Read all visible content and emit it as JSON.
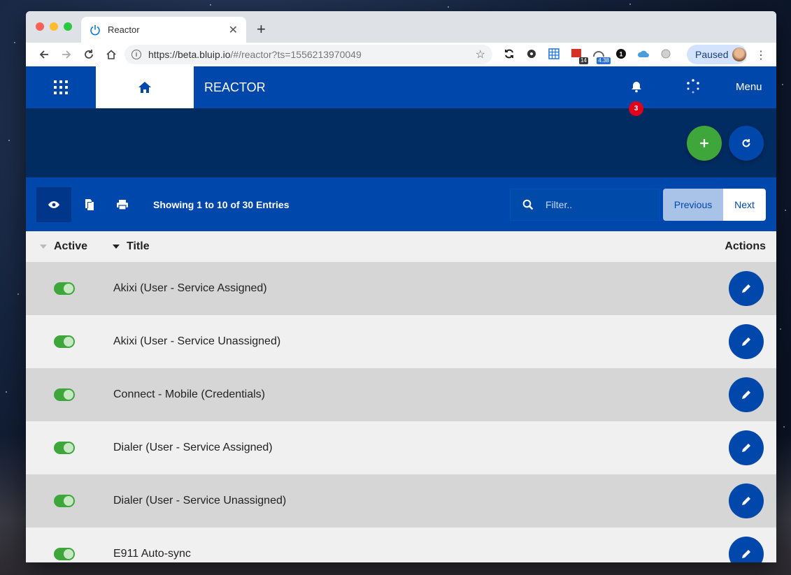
{
  "browser": {
    "tab_title": "Reactor",
    "url_host": "https://beta.bluip.io",
    "url_path": "/#/reactor?ts=1556213970049",
    "profile_status": "Paused",
    "extensions": [
      {
        "name": "sync-icon"
      },
      {
        "name": "puzzle-icon"
      },
      {
        "name": "grid-icon"
      },
      {
        "name": "calendar-icon",
        "badge": "14",
        "badge_color": "#3a3a3a"
      },
      {
        "name": "speed-icon",
        "badge": "4.38",
        "badge_color": "#2a6fd6"
      },
      {
        "name": "one-icon"
      },
      {
        "name": "cloud-icon"
      },
      {
        "name": "circle-icon"
      }
    ]
  },
  "app": {
    "title": "REACTOR",
    "notification_count": "3",
    "menu_label": "Menu",
    "colors": {
      "primary": "#0047ab",
      "dark": "#002c62",
      "success": "#3fa63c",
      "alert": "#e0001b"
    }
  },
  "toolbar": {
    "showing_text": "Showing 1 to 10 of 30 Entries",
    "filter_placeholder": "Filter..",
    "prev_label": "Previous",
    "next_label": "Next"
  },
  "table": {
    "headers": {
      "active": "Active",
      "title": "Title",
      "actions": "Actions"
    },
    "rows": [
      {
        "title": "Akixi (User - Service Assigned)",
        "active": true
      },
      {
        "title": "Akixi (User - Service Unassigned)",
        "active": true
      },
      {
        "title": "Connect - Mobile (Credentials)",
        "active": true
      },
      {
        "title": "Dialer (User - Service Assigned)",
        "active": true
      },
      {
        "title": "Dialer (User - Service Unassigned)",
        "active": true
      },
      {
        "title": "E911 Auto-sync",
        "active": true
      }
    ]
  }
}
